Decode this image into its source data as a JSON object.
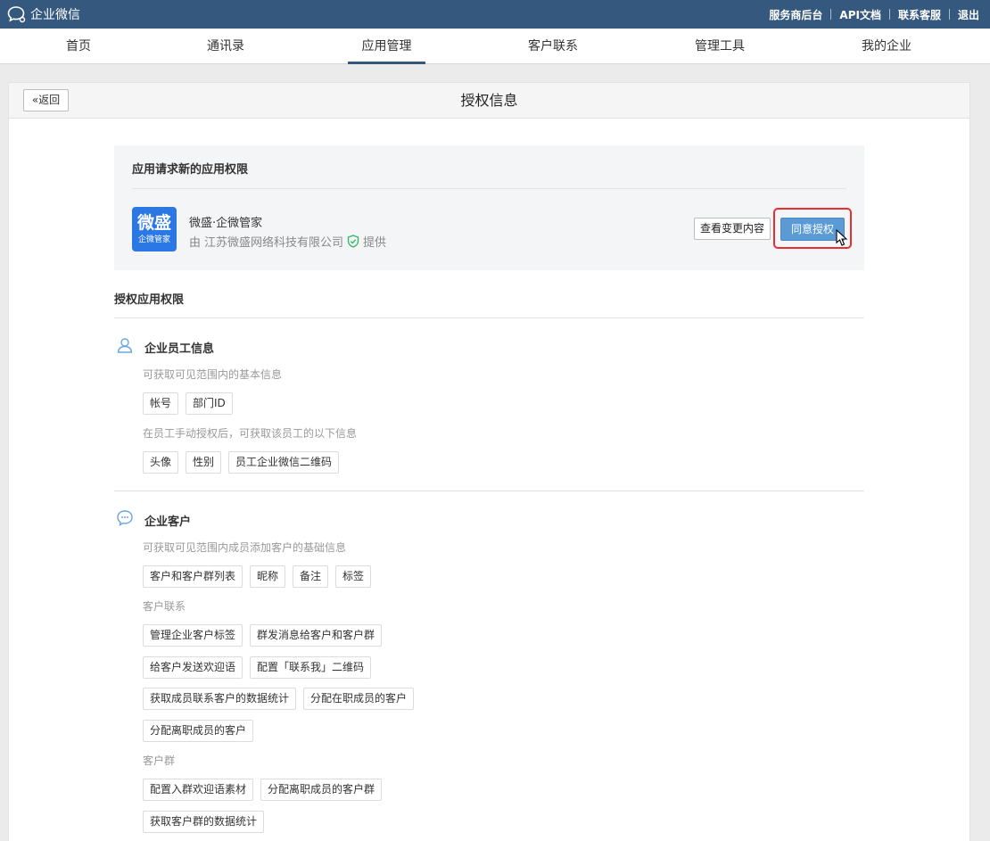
{
  "topbar": {
    "logo_text": "企业微信",
    "links": [
      "服务商后台",
      "API文档",
      "联系客服",
      "退出"
    ]
  },
  "nav": {
    "items": [
      "首页",
      "通讯录",
      "应用管理",
      "客户联系",
      "管理工具",
      "我的企业"
    ],
    "active_index": 2
  },
  "panel": {
    "back_label": "返回",
    "title": "授权信息"
  },
  "request": {
    "title": "应用请求新的应用权限",
    "app_icon_big": "微盛",
    "app_icon_small": "企微管家",
    "app_name": "微盛·企微管家",
    "provider_prefix": "由",
    "provider_name": "江苏微盛网络科技有限公司",
    "provider_suffix": "提供",
    "view_changes_label": "查看变更内容",
    "agree_label": "同意授权"
  },
  "permissions": {
    "heading": "授权应用权限",
    "employee": {
      "title": "企业员工信息",
      "sub1": "可获取可见范围内的基本信息",
      "tags1": [
        "帐号",
        "部门ID"
      ],
      "sub2": "在员工手动授权后，可获取该员工的以下信息",
      "tags2": [
        "头像",
        "性别",
        "员工企业微信二维码"
      ]
    },
    "customer": {
      "title": "企业客户",
      "sub1": "可获取可见范围内成员添加客户的基础信息",
      "tags1": [
        "客户和客户群列表",
        "昵称",
        "备注",
        "标签"
      ],
      "sub2": "客户联系",
      "tags2a": [
        "管理企业客户标签",
        "群发消息给客户和客户群"
      ],
      "tags2b": [
        "给客户发送欢迎语",
        "配置「联系我」二维码"
      ],
      "tags2c": [
        "获取成员联系客户的数据统计",
        "分配在职成员的客户"
      ],
      "tags2d": [
        "分配离职成员的客户"
      ],
      "sub3": "客户群",
      "tags3a": [
        "配置入群欢迎语素材",
        "分配离职成员的客户群"
      ],
      "tags3b": [
        "获取客户群的数据统计"
      ]
    }
  },
  "colors": {
    "topbar_bg": "#35587f",
    "agree_button": "#5b9bd5",
    "highlight_border": "#e82e2e",
    "app_icon_bg": "#2b78e4"
  }
}
